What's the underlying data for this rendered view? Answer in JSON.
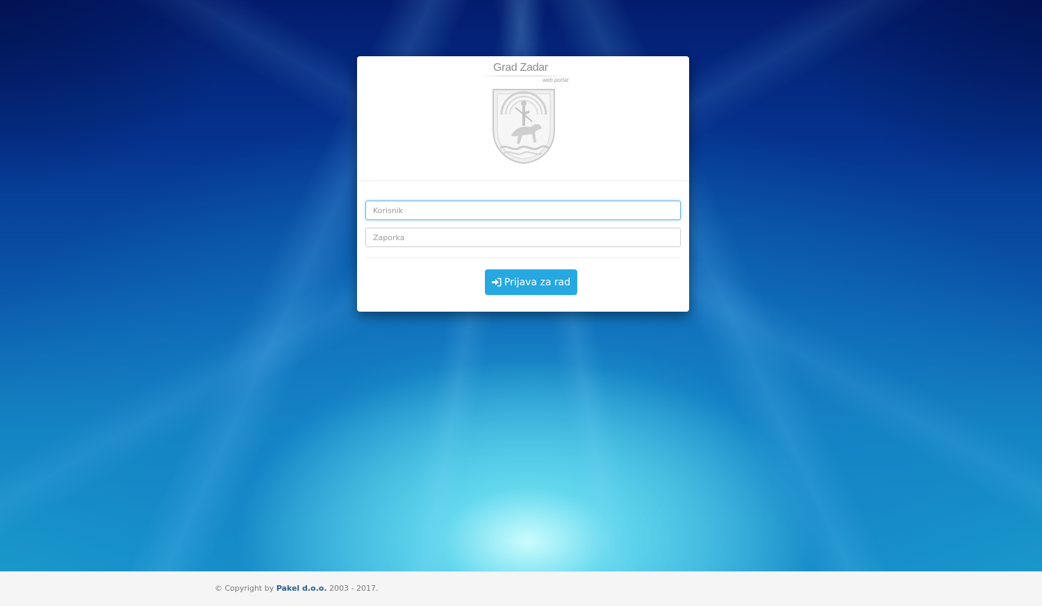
{
  "login": {
    "brand_title": "Grad Zadar",
    "brand_subtitle": "web portal",
    "crest_icon": "city-coat-of-arms-icon",
    "username_placeholder": "Korisnik",
    "password_placeholder": "Zaporka",
    "submit_label": "Prijava za rad",
    "submit_icon": "sign-in-icon",
    "button_color": "#27a8e0"
  },
  "footer": {
    "copyright_prefix": "© Copyright by",
    "company": "Pakel d.o.o.",
    "years": "2003 - 2017."
  }
}
